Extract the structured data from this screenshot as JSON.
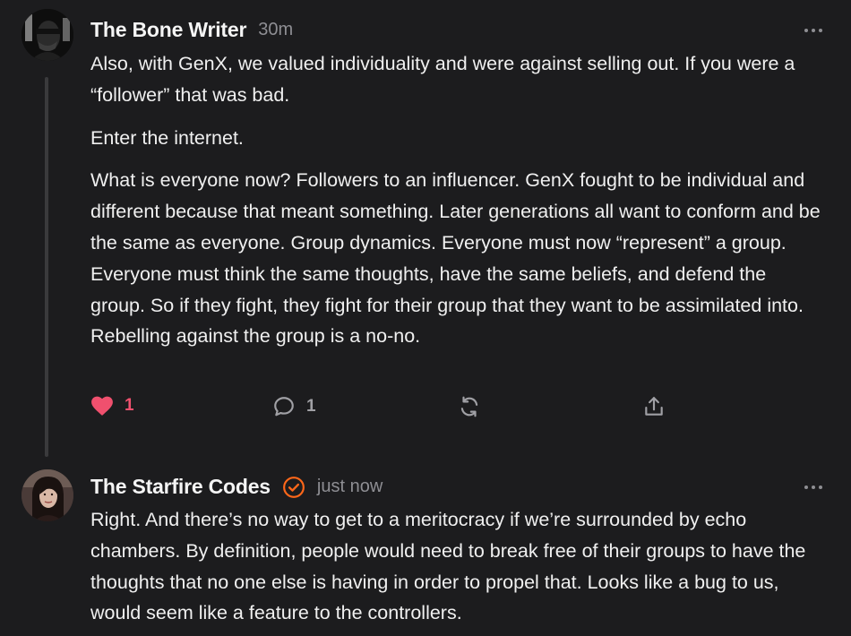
{
  "comments": [
    {
      "author": "The Bone Writer",
      "time": "30m",
      "paragraphs": [
        "Also, with GenX, we valued individuality and were against selling out. If you were a “follower” that was bad.",
        "Enter the internet.",
        "What is everyone now? Followers to an influencer. GenX fought to be individual and different because that meant something. Later generations all want to conform and be the same as everyone. Group dynamics. Everyone must now “represent” a group. Everyone must think the same thoughts, have the same beliefs, and defend the group. So if they fight, they fight for their group that they want to be assimilated into. Rebelling against the group is a no-no."
      ],
      "likes": "1",
      "replies": "1",
      "icons": {
        "like": "heart-icon",
        "reply": "comment-bubble-icon",
        "restack": "restack-icon",
        "share": "share-icon",
        "more": "more-dots-icon"
      }
    },
    {
      "author": "The Starfire Codes",
      "time": "just now",
      "verified_icon": "verified-check-icon",
      "paragraphs": [
        "Right. And there’s no way to get to a meritocracy if we’re surrounded by echo chambers. By definition, people would need to break free of their groups to have the thoughts that no one else is having in order to propel that. Looks like a bug to us, would seem like a feature to the controllers."
      ]
    }
  ],
  "colors": {
    "background": "#1c1c1e",
    "like_accent": "#f0506e",
    "verified_accent": "#ff6719",
    "muted": "#8e8e93"
  }
}
